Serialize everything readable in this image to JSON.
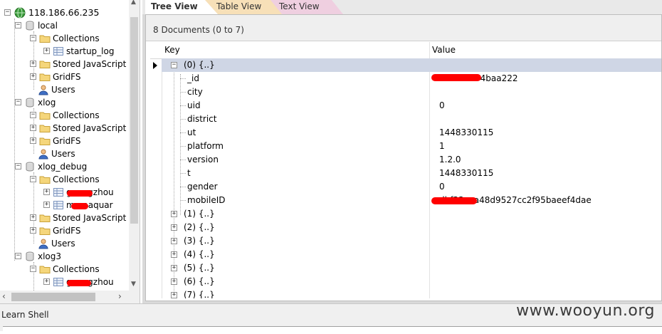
{
  "tree": {
    "server": "118.186.66.235",
    "nodes": [
      {
        "id": "local",
        "label": "local",
        "type": "db"
      },
      {
        "id": "local_collections",
        "label": "Collections",
        "type": "folder"
      },
      {
        "id": "startup_log",
        "label": "startup_log",
        "type": "collection"
      },
      {
        "id": "local_storedjs",
        "label": "Stored JavaScript",
        "type": "folder"
      },
      {
        "id": "local_gridfs",
        "label": "GridFS",
        "type": "folder"
      },
      {
        "id": "local_users",
        "label": "Users",
        "type": "users"
      },
      {
        "id": "xlog",
        "label": "xlog",
        "type": "db"
      },
      {
        "id": "xlog_collections",
        "label": "Collections",
        "type": "folder"
      },
      {
        "id": "xlog_storedjs",
        "label": "Stored JavaScript",
        "type": "folder"
      },
      {
        "id": "xlog_gridfs",
        "label": "GridFS",
        "type": "folder"
      },
      {
        "id": "xlog_users",
        "label": "Users",
        "type": "users"
      },
      {
        "id": "xlog_debug",
        "label": "xlog_debug",
        "type": "db"
      },
      {
        "id": "xlog_debug_collections",
        "label": "Collections",
        "type": "folder"
      },
      {
        "id": "coll_guangzhou1",
        "label": "guangzhou",
        "type": "collection"
      },
      {
        "id": "coll_mamaquan",
        "label": "mamaquar",
        "type": "collection"
      },
      {
        "id": "xlog_debug_storedjs",
        "label": "Stored JavaScript",
        "type": "folder"
      },
      {
        "id": "xlog_debug_gridfs",
        "label": "GridFS",
        "type": "folder"
      },
      {
        "id": "xlog_debug_users",
        "label": "Users",
        "type": "users"
      },
      {
        "id": "xlog3",
        "label": "xlog3",
        "type": "db"
      },
      {
        "id": "xlog3_collections",
        "label": "Collections",
        "type": "folder"
      },
      {
        "id": "coll_guangzhou2",
        "label": "guangzhou",
        "type": "collection"
      }
    ]
  },
  "tabs": {
    "tree": "Tree View",
    "table": "Table View",
    "text": "Text View"
  },
  "documents": {
    "count_label": "8 Documents (0 to 7)",
    "col_key": "Key",
    "col_value": "Value",
    "doc0": "(0) {..}",
    "fields": [
      {
        "key": "_id",
        "value": "0642f7074baa222"
      },
      {
        "key": "city",
        "value": ""
      },
      {
        "key": "uid",
        "value": "0"
      },
      {
        "key": "district",
        "value": ""
      },
      {
        "key": "ut",
        "value": "1448330115"
      },
      {
        "key": "platform",
        "value": "1"
      },
      {
        "key": "version",
        "value": "1.2.0"
      },
      {
        "key": "t",
        "value": "1448330115"
      },
      {
        "key": "gender",
        "value": "0"
      },
      {
        "key": "mobileID",
        "value": "dbf33eca48d9527cc2f95baeef4dae"
      }
    ],
    "collapsed": [
      "(1) {..}",
      "(2) {..}",
      "(3) {..}",
      "(4) {..}",
      "(5) {..}",
      "(6) {..}",
      "(7) {..}"
    ]
  },
  "bottom": {
    "shell_label": "Learn Shell",
    "watermark": "www.wooyun.org"
  },
  "colors": {
    "selected_row": "#cfd6e5",
    "tab_table": "#f7e0b8",
    "tab_text": "#efcfe0",
    "redaction": "#ff0000"
  }
}
